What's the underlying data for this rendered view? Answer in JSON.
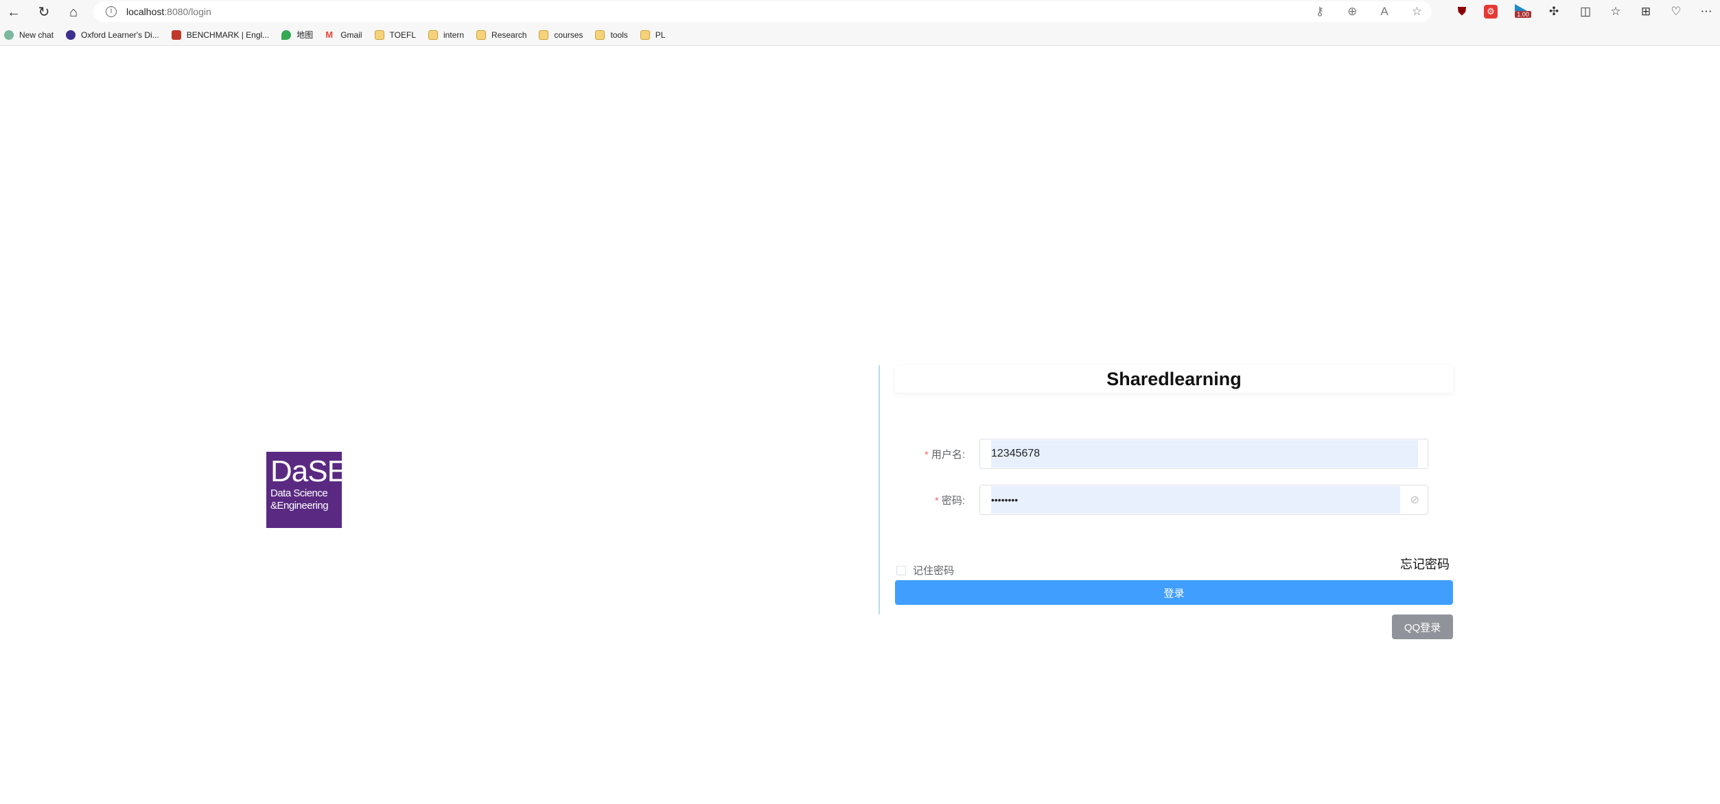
{
  "browser": {
    "url_host": "localhost",
    "url_path": ":8080/login",
    "bookmarks": [
      {
        "label": "New chat",
        "icon": "chatgpt-icon"
      },
      {
        "label": "Oxford Learner's Di...",
        "icon": "oxford-icon"
      },
      {
        "label": "BENCHMARK | Engl...",
        "icon": "cambridge-icon"
      },
      {
        "label": "地图",
        "icon": "maps-icon"
      },
      {
        "label": "Gmail",
        "icon": "gmail-icon"
      },
      {
        "label": "TOEFL",
        "icon": "folder-icon"
      },
      {
        "label": "intern",
        "icon": "folder-icon"
      },
      {
        "label": "Research",
        "icon": "folder-icon"
      },
      {
        "label": "courses",
        "icon": "folder-icon"
      },
      {
        "label": "tools",
        "icon": "folder-icon"
      },
      {
        "label": "PL",
        "icon": "folder-icon"
      }
    ],
    "extension_badge": "1.00"
  },
  "logo": {
    "line1": "DaSE",
    "line2": "Data Science",
    "line3": "&Engineering",
    "color": "#5a2a82"
  },
  "login": {
    "title": "Sharedlearning",
    "username_label": "用户名:",
    "username_value": "12345678",
    "password_label": "密码:",
    "password_value": "••••••••",
    "required_mark": "*",
    "remember_label": "记住密码",
    "remember_checked": false,
    "forgot_label": "忘记密码",
    "login_button": "登录",
    "qq_button": "QQ登录",
    "accent": "#409eff"
  }
}
